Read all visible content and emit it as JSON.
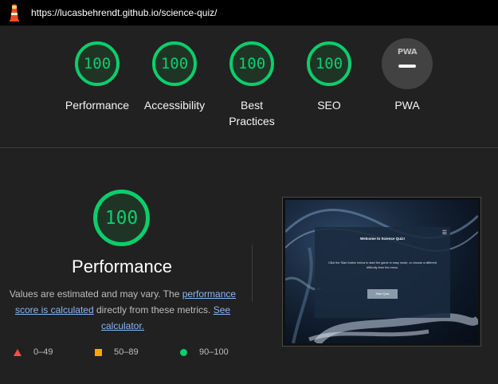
{
  "url": "https://lucasbehrendt.github.io/science-quiz/",
  "categories": [
    {
      "key": "performance",
      "score": "100",
      "label": "Performance"
    },
    {
      "key": "accessibility",
      "score": "100",
      "label": "Accessibility"
    },
    {
      "key": "best-practices",
      "score": "100",
      "label": "Best Practices"
    },
    {
      "key": "seo",
      "score": "100",
      "label": "SEO"
    }
  ],
  "pwa": {
    "badge": "PWA",
    "label": "PWA"
  },
  "performance_detail": {
    "score": "100",
    "title": "Performance",
    "desc_prefix": "Values are estimated and may vary. The ",
    "link1": "performance score is calculated",
    "desc_mid": " directly from these metrics. ",
    "link2": "See calculator."
  },
  "legend": [
    {
      "shape": "triangle",
      "range": "0–49",
      "color": "#ff4e42"
    },
    {
      "shape": "square",
      "range": "50–89",
      "color": "#ffa400"
    },
    {
      "shape": "circle",
      "range": "90–100",
      "color": "#0cce6b"
    }
  ],
  "screenshot": {
    "title": "Welcome to Science Quiz!",
    "text": "Click the Start button below to start the game in easy mode, or choose a different difficulty from the menu.",
    "button": "Start Quiz",
    "menu_icon": "☰"
  },
  "colors": {
    "pass": "#0cce6b",
    "average": "#ffa400",
    "fail": "#ff4e42",
    "background": "#212121"
  }
}
